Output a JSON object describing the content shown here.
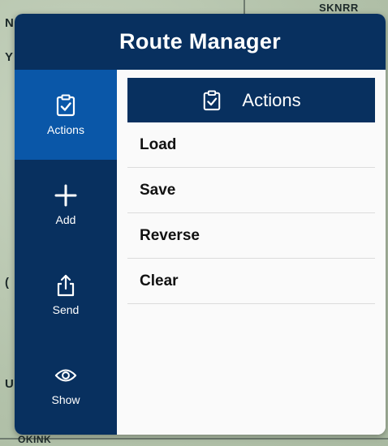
{
  "map": {
    "top_label": "SKNRR",
    "bottom_label": "OKINK"
  },
  "panel": {
    "title": "Route Manager"
  },
  "sidebar": {
    "items": [
      {
        "label": "Actions",
        "icon": "clipboard-check-icon",
        "active": true
      },
      {
        "label": "Add",
        "icon": "plus-icon",
        "active": false
      },
      {
        "label": "Send",
        "icon": "share-icon",
        "active": false
      },
      {
        "label": "Show",
        "icon": "eye-icon",
        "active": false
      }
    ]
  },
  "content": {
    "header": {
      "label": "Actions",
      "icon": "clipboard-check-icon"
    },
    "actions": [
      {
        "label": "Load"
      },
      {
        "label": "Save"
      },
      {
        "label": "Reverse"
      },
      {
        "label": "Clear"
      }
    ]
  },
  "colors": {
    "navy": "#08305f",
    "active_blue": "#0a57a8",
    "list_bg": "#fafafa",
    "divider": "#dcdcdc"
  }
}
